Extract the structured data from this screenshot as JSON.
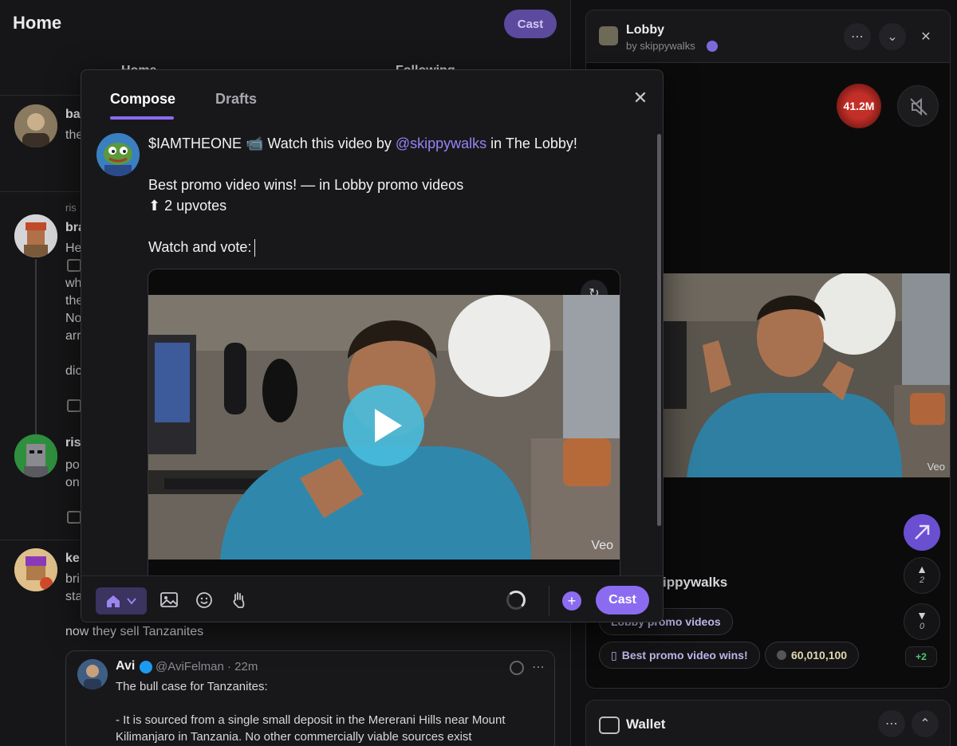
{
  "feed": {
    "title": "Home",
    "cast_button": "Cast",
    "tabs": [
      "Home",
      "Following"
    ],
    "posts": [
      {
        "author": "ba",
        "text": "the"
      },
      {
        "recast": "ris",
        "author": "bra",
        "text": "He\n\nwh\nthe\nNo\narr\n\ndic"
      },
      {
        "author": "ris",
        "text": "po\non"
      },
      {
        "author": "ke",
        "text": "bri\nsta"
      }
    ],
    "tanzanite_line": "now they sell Tanzanites",
    "quote": {
      "name": "Avi",
      "handle": "@AviFelman · 22m",
      "body": "The bull case for Tanzanites:\n\n- It is sourced from a single small deposit in the Mererani Hills near Mount\nKilimanjaro in Tanzania. No other commercially viable sources exist"
    }
  },
  "lobby": {
    "title": "Lobby",
    "by": "by skippywalks",
    "viewers": "41.2M",
    "veo": "Veo",
    "owner": "ippywalks",
    "upvotes": "2",
    "downvotes": "0",
    "plus": "+2",
    "chips": [
      "Lobby promo videos",
      "Best promo video wins!",
      "60,010,100"
    ]
  },
  "wallet": {
    "title": "Wallet"
  },
  "compose": {
    "tabs": {
      "compose": "Compose",
      "drafts": "Drafts"
    },
    "line1_pre": "$IAMTHEONE 📹 Watch this video by ",
    "line1_mention": "@skippywalks",
    "line1_post": " in The Lobby!",
    "line2": "Best promo video wins! — in Lobby promo videos",
    "line3": "⬆ 2 upvotes",
    "line4": "Watch and vote:",
    "embed_veo": "Veo",
    "cast_button": "Cast"
  },
  "colors": {
    "accent": "#8b6cf0",
    "play": "#48bede",
    "badge": "#c32f28"
  }
}
